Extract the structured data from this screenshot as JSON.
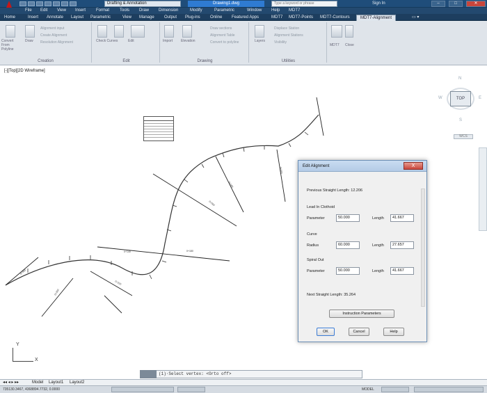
{
  "app": {
    "workspace": "Drafting & Annotation",
    "drawing_tab": "Drawing1.dwg",
    "search_placeholder": "Type a keyword or phrase",
    "sign_in": "Sign In"
  },
  "menubar": [
    "File",
    "Edit",
    "View",
    "Insert",
    "Format",
    "Tools",
    "Draw",
    "Dimension",
    "Modify",
    "Parametric",
    "Window",
    "Help",
    "MDT7"
  ],
  "ribbon_tabs": [
    "Home",
    "Insert",
    "Annotate",
    "Layout",
    "Parametric",
    "View",
    "Manage",
    "Output",
    "Plug-ins",
    "Online",
    "Featured Apps",
    "MDT7",
    "MDT7-Points",
    "MDT7-Contours",
    "MDT7-Alignment"
  ],
  "active_tab": "MDT7-Alignment",
  "ribbon": {
    "creation": {
      "title": "Creation",
      "commands": [
        "Convert From Polyline",
        "Draw",
        "Alignment input",
        "Create Alignment",
        "Resolution Alignment"
      ]
    },
    "edit": {
      "title": "Edit",
      "commands": [
        "Check Curves",
        "Edit"
      ]
    },
    "drawing": {
      "title": "Drawing",
      "commands": [
        "Import",
        "Elevation",
        "Draw sections",
        "Alignment Table",
        "Convert to polyline"
      ]
    },
    "utilities": {
      "title": "Utilities",
      "commands": [
        "Layers",
        "Displace Station",
        "Alignment Stations",
        "Visibility"
      ]
    },
    "mdt7": {
      "commands": [
        "MDT7",
        "Close"
      ]
    }
  },
  "viewport": {
    "label": "[-][Top][2D Wireframe]"
  },
  "viewcube": {
    "top": "TOP",
    "north": "N",
    "south": "S",
    "east": "E",
    "west": "W",
    "wcs": "WCS"
  },
  "ucs": {
    "x": "X",
    "y": "Y"
  },
  "command_line": {
    "text": "(1)·Select vertex: <Orto off>"
  },
  "layout_tabs": [
    "Model",
    "Layout1",
    "Layout2"
  ],
  "status_bar": {
    "coords": "735130.3467, 4368894.7732, 0.0000",
    "model_label": "MODEL"
  },
  "dialog": {
    "title": "Edit Alignment",
    "close_symbol": "X",
    "previous_straight": "Previous Straight Length: 12.206",
    "lead_in_title": "Lead In Clothoid",
    "lead_in_parameter_label": "Parameter",
    "lead_in_parameter": "50.000",
    "lead_in_length_label": "Length",
    "lead_in_length": "41.667",
    "curve_title": "Curve",
    "curve_radius_label": "Radius",
    "curve_radius": "60.000",
    "curve_length_label": "Length",
    "curve_length": "27.657",
    "spiral_out_title": "Spiral Out",
    "spiral_parameter_label": "Parameter",
    "spiral_parameter": "50.000",
    "spiral_length_label": "Length",
    "spiral_length": "41.667",
    "next_straight": "Next Straight Length: 35.264",
    "instruction_button": "Instruction Parameters",
    "ok": "OK",
    "cancel": "Cancel",
    "help": "Help"
  },
  "colors": {
    "accent": "#1f4d7a",
    "ribbon": "#dfe4ea",
    "dialog_title": "#c9dcf1"
  }
}
